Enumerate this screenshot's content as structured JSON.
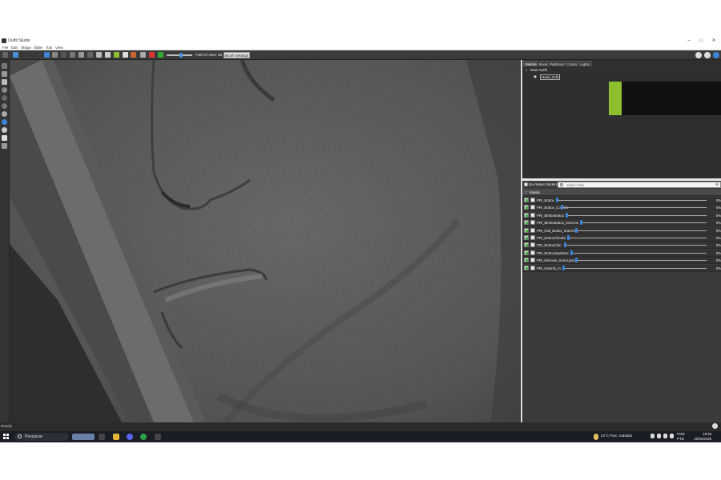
{
  "window": {
    "title": "Outfit Studio"
  },
  "menu": [
    "File",
    "Edit",
    "Shape",
    "Slider",
    "Tool",
    "View"
  ],
  "toolbar": {
    "fov_label": "Field of View: 65",
    "brush_settings_label": "Brush Settings"
  },
  "panel": {
    "tabs": [
      "Meshes",
      "Bones",
      "Partitions",
      "Colors",
      "Lights"
    ],
    "active_tab": "Meshes",
    "tree": {
      "root": "New Outfit",
      "child": "Head_Edit"
    },
    "deselect_label": "De-/Select Sliders",
    "filter_placeholder": "Slider Filter",
    "masks_label": "Masks",
    "sliders": [
      {
        "name": "PRI_Bottox",
        "value": "0%"
      },
      {
        "name": "PRI_Bottox_Counter",
        "value": "0%"
      },
      {
        "name": "PRI_BimboBottox",
        "value": "0%"
      },
      {
        "name": "PRI_BimboBottox_Extreme",
        "value": "0%"
      },
      {
        "name": "PRI_Doll_Bottox_Extreme",
        "value": "0%"
      },
      {
        "name": "PRI_BottoxCheeks",
        "value": "0%"
      },
      {
        "name": "PRI_BottoxChin",
        "value": "0%"
      },
      {
        "name": "PRI_BottoxJawMass",
        "value": "0%"
      },
      {
        "name": "PRI_Remove_InnerLips1",
        "value": "0%"
      },
      {
        "name": "PRI_Nostrils_In",
        "value": "0%"
      }
    ]
  },
  "status": {
    "text": "Ready!"
  },
  "taskbar": {
    "search_label": "Pesquisar",
    "weather": "24°C  Parc. nublado",
    "lang": "POR",
    "lang2": "PTB",
    "time": "19:55",
    "date": "20/04/2026"
  },
  "colors": {
    "accent": "#3d85d6",
    "preview_green": "#8dbf2f"
  }
}
